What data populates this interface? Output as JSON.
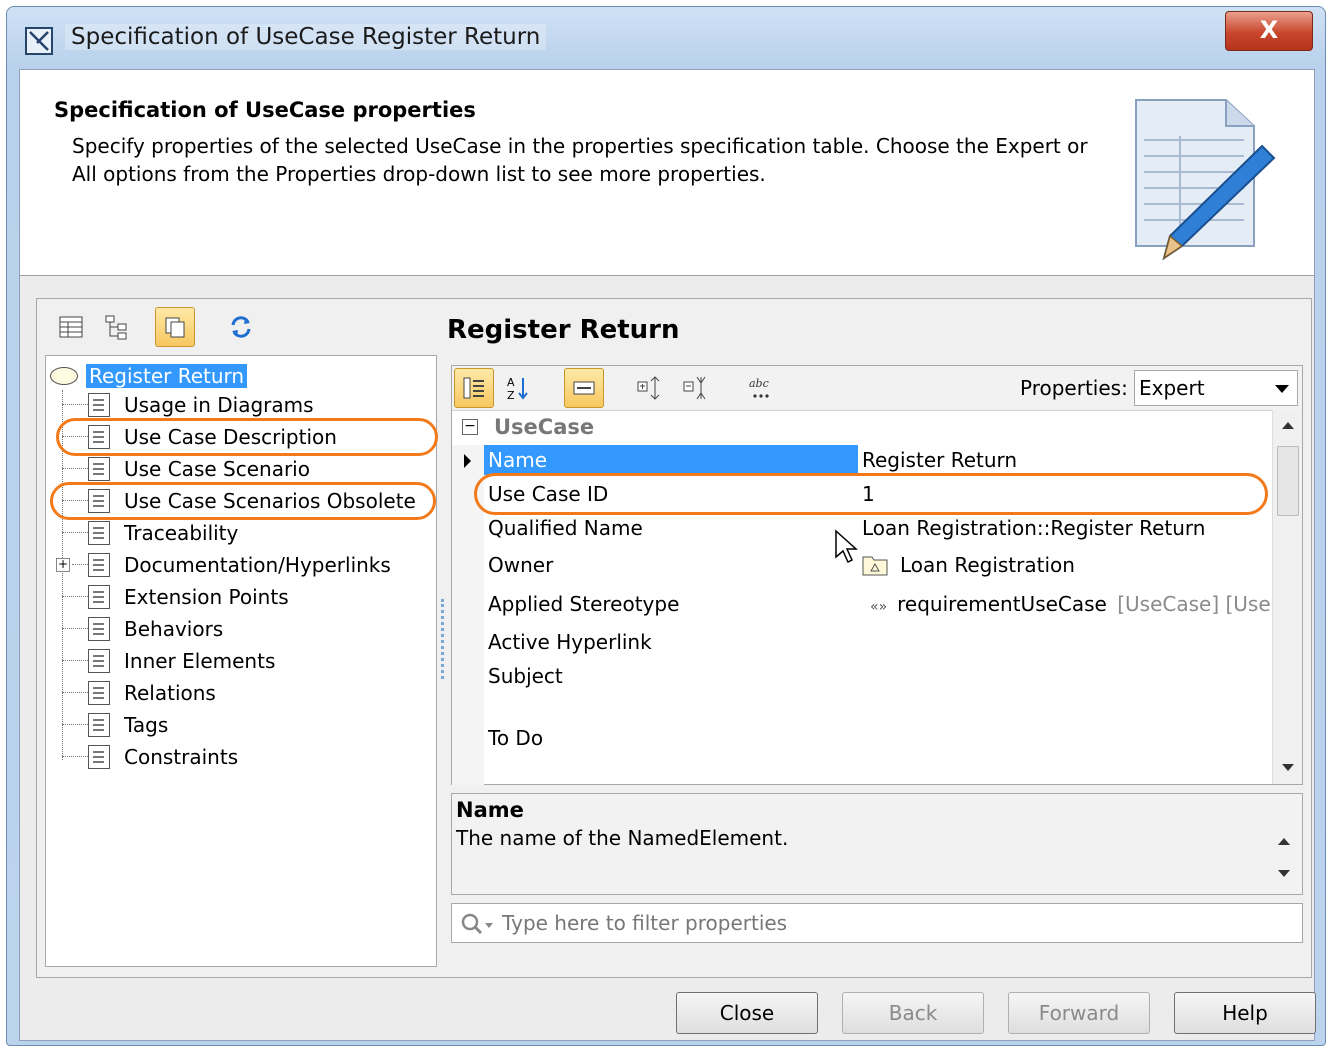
{
  "window": {
    "title": "Specification of UseCase Register Return",
    "close_glyph": "X"
  },
  "header": {
    "title": "Specification of UseCase properties",
    "description": "Specify properties of the selected UseCase in the properties specification table. Choose the Expert or All options from the Properties drop-down list to see more properties."
  },
  "tree": {
    "root": "Register Return",
    "items": [
      {
        "label": "Usage in Diagrams"
      },
      {
        "label": "Use Case Description"
      },
      {
        "label": "Use Case Scenario"
      },
      {
        "label": "Use Case Scenarios Obsolete"
      },
      {
        "label": "Traceability"
      },
      {
        "label": "Documentation/Hyperlinks"
      },
      {
        "label": "Extension Points"
      },
      {
        "label": "Behaviors"
      },
      {
        "label": "Inner Elements"
      },
      {
        "label": "Relations"
      },
      {
        "label": "Tags"
      },
      {
        "label": "Constraints"
      }
    ]
  },
  "panel": {
    "title": "Register Return",
    "properties_label": "Properties:",
    "properties_value": "Expert",
    "group": "UseCase",
    "rows": [
      {
        "name": "Name",
        "value": "Register Return"
      },
      {
        "name": "Use Case ID",
        "value": "1"
      },
      {
        "name": "Qualified Name",
        "value": "Loan Registration::Register Return"
      },
      {
        "name": "Owner",
        "value": "Loan Registration"
      },
      {
        "name": "Applied Stereotype",
        "value": "requirementUseCase",
        "value_extra": "[UseCase] [Use"
      },
      {
        "name": "Active Hyperlink",
        "value": ""
      },
      {
        "name": "Subject",
        "value": ""
      },
      {
        "name": "To Do",
        "value": ""
      }
    ],
    "description_title": "Name",
    "description_text": "The name of the NamedElement.",
    "filter_placeholder": "Type here to filter properties"
  },
  "buttons": {
    "close": "Close",
    "back": "Back",
    "forward": "Forward",
    "help": "Help"
  },
  "colors": {
    "selection": "#3399ff",
    "highlight": "#f27a1b"
  }
}
